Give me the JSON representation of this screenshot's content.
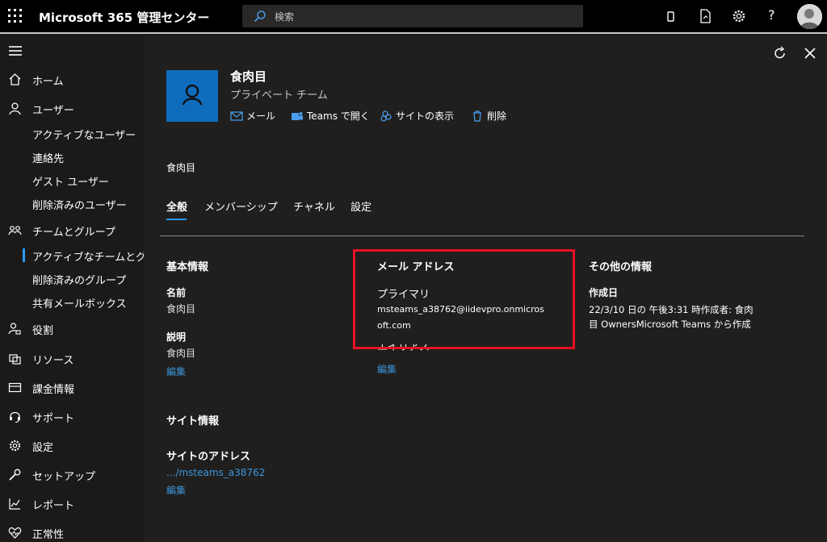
{
  "header": {
    "app_title": "Microsoft 365 管理センター",
    "search_placeholder": "検索",
    "help_label": "?"
  },
  "sidebar": {
    "items": [
      {
        "label": "ホーム",
        "icon": "home-icon"
      },
      {
        "label": "ユーザー",
        "icon": "person-icon"
      },
      {
        "label": "チームとグループ",
        "icon": "teams-groups-icon"
      },
      {
        "label": "役割",
        "icon": "roles-icon"
      },
      {
        "label": "リソース",
        "icon": "resources-icon"
      },
      {
        "label": "課金情報",
        "icon": "billing-icon"
      },
      {
        "label": "サポート",
        "icon": "headset-icon"
      },
      {
        "label": "設定",
        "icon": "gear-icon"
      },
      {
        "label": "セットアップ",
        "icon": "wrench-icon"
      },
      {
        "label": "レポート",
        "icon": "chart-icon"
      },
      {
        "label": "正常性",
        "icon": "heart-icon"
      }
    ],
    "user_sub": [
      "アクティブなユーザー",
      "連絡先",
      "ゲスト ユーザー",
      "削除済みのユーザー"
    ],
    "team_sub": [
      "アクティブなチームとグ",
      "削除済みのグループ",
      "共有メールボックス"
    ]
  },
  "panel": {
    "title": "食肉目",
    "subtitle": "プライベート チーム",
    "actions": [
      {
        "label": "メール",
        "icon": "mail-icon"
      },
      {
        "label": "Teams で開く",
        "icon": "teams-icon"
      },
      {
        "label": "サイトの表示",
        "icon": "sharepoint-icon"
      },
      {
        "label": "削除",
        "icon": "trash-icon"
      }
    ],
    "name_line": "食肉目",
    "tabs": [
      "全般",
      "メンバーシップ",
      "チャネル",
      "設定"
    ],
    "basic": {
      "heading": "基本情報",
      "name_label": "名前",
      "name_value": "食肉目",
      "desc_label": "説明",
      "desc_value": "食肉目",
      "edit": "編集"
    },
    "email": {
      "heading": "メール アドレス",
      "primary_label": "プライマリ",
      "primary_value_1": "msteams_a38762@iidevpro.onmicros",
      "primary_value_2": "oft.com",
      "alias_label": "エイリアス",
      "edit": "編集"
    },
    "other": {
      "heading": "その他の情報",
      "created_label": "作成日",
      "created_value_1": "22/3/10 日の 午後3:31 時作成者: 食肉",
      "created_value_2": "目 OwnersMicrosoft Teams から作成"
    },
    "site": {
      "heading": "サイト情報",
      "address_label": "サイトのアドレス",
      "address_value": ".../msteams_a38762",
      "edit": "編集"
    }
  },
  "colors": {
    "accent": "#2899f5",
    "link": "#3a96dd",
    "highlight": "#e81123",
    "tile": "#0f6cbd"
  }
}
